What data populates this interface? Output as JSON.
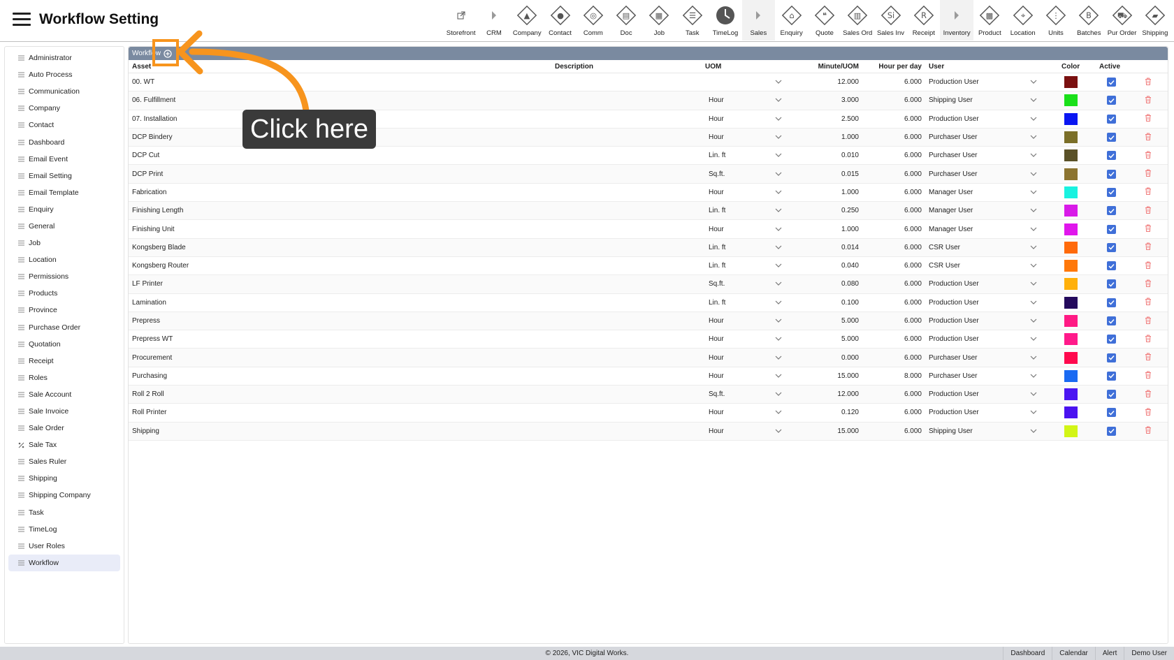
{
  "header": {
    "title": "Workflow Setting",
    "nav": [
      {
        "label": "Storefront",
        "icon": "external-link-icon",
        "group": false
      },
      {
        "label": "CRM",
        "icon": "caret-right-icon",
        "group": false
      },
      {
        "label": "Company",
        "icon": "company-icon",
        "group": false
      },
      {
        "label": "Contact",
        "icon": "contact-icon",
        "group": false
      },
      {
        "label": "Comm",
        "icon": "comm-icon",
        "group": false
      },
      {
        "label": "Doc",
        "icon": "doc-icon",
        "group": false
      },
      {
        "label": "Job",
        "icon": "job-icon",
        "group": false
      },
      {
        "label": "Task",
        "icon": "task-icon",
        "group": false
      },
      {
        "label": "TimeLog",
        "icon": "clock-icon",
        "group": false
      },
      {
        "label": "Sales",
        "icon": "caret-right-icon",
        "group": true
      },
      {
        "label": "Enquiry",
        "icon": "enquiry-icon",
        "group": false
      },
      {
        "label": "Quote",
        "icon": "quote-icon",
        "group": false
      },
      {
        "label": "Sales Ord",
        "icon": "sales-order-icon",
        "group": false
      },
      {
        "label": "Sales Inv",
        "icon": "sales-invoice-icon",
        "group": false
      },
      {
        "label": "Receipt",
        "icon": "receipt-icon",
        "group": false
      },
      {
        "label": "Inventory",
        "icon": "caret-right-icon",
        "group": true
      },
      {
        "label": "Product",
        "icon": "product-icon",
        "group": false
      },
      {
        "label": "Location",
        "icon": "location-icon",
        "group": false
      },
      {
        "label": "Units",
        "icon": "units-icon",
        "group": false
      },
      {
        "label": "Batches",
        "icon": "batches-icon",
        "group": false
      },
      {
        "label": "Pur Order",
        "icon": "purchase-order-icon",
        "group": false
      },
      {
        "label": "Shipping",
        "icon": "shipping-icon",
        "group": false
      }
    ]
  },
  "sidebar": {
    "items": [
      {
        "label": "Administrator"
      },
      {
        "label": "Auto Process"
      },
      {
        "label": "Communication"
      },
      {
        "label": "Company"
      },
      {
        "label": "Contact"
      },
      {
        "label": "Dashboard"
      },
      {
        "label": "Email Event"
      },
      {
        "label": "Email Setting"
      },
      {
        "label": "Email Template"
      },
      {
        "label": "Enquiry"
      },
      {
        "label": "General"
      },
      {
        "label": "Job"
      },
      {
        "label": "Location"
      },
      {
        "label": "Permissions"
      },
      {
        "label": "Products"
      },
      {
        "label": "Province"
      },
      {
        "label": "Purchase Order"
      },
      {
        "label": "Quotation"
      },
      {
        "label": "Receipt"
      },
      {
        "label": "Roles"
      },
      {
        "label": "Sale Account"
      },
      {
        "label": "Sale Invoice"
      },
      {
        "label": "Sale Order"
      },
      {
        "label": "Sale Tax",
        "icon": "percent-icon"
      },
      {
        "label": "Sales Ruler"
      },
      {
        "label": "Shipping"
      },
      {
        "label": "Shipping Company"
      },
      {
        "label": "Task"
      },
      {
        "label": "TimeLog"
      },
      {
        "label": "User Roles"
      },
      {
        "label": "Workflow",
        "active": true
      }
    ]
  },
  "panel": {
    "title": "Workflow",
    "columns": {
      "asset": "Asset",
      "description": "Description",
      "uom": "UOM",
      "minute_uom": "Minute/UOM",
      "hour_per_day": "Hour per day",
      "user": "User",
      "color": "Color",
      "active": "Active"
    },
    "rows": [
      {
        "asset": "00. WT",
        "description": "",
        "uom": "",
        "minute": "12.000",
        "hours": "6.000",
        "user": "Production User",
        "color": "#7a1010",
        "active": true
      },
      {
        "asset": "06. Fulfillment",
        "description": "",
        "uom": "Hour",
        "minute": "3.000",
        "hours": "6.000",
        "user": "Shipping User",
        "color": "#1ae01a",
        "active": true
      },
      {
        "asset": "07. Installation",
        "description": "",
        "uom": "Hour",
        "minute": "2.500",
        "hours": "6.000",
        "user": "Production User",
        "color": "#0a16f2",
        "active": true
      },
      {
        "asset": "DCP Bindery",
        "description": "",
        "uom": "Hour",
        "minute": "1.000",
        "hours": "6.000",
        "user": "Purchaser User",
        "color": "#7b6f28",
        "active": true
      },
      {
        "asset": "DCP Cut",
        "description": "",
        "uom": "Lin. ft",
        "minute": "0.010",
        "hours": "6.000",
        "user": "Purchaser User",
        "color": "#5a5128",
        "active": true
      },
      {
        "asset": "DCP Print",
        "description": "",
        "uom": "Sq.ft.",
        "minute": "0.015",
        "hours": "6.000",
        "user": "Purchaser User",
        "color": "#8c7430",
        "active": true
      },
      {
        "asset": "Fabrication",
        "description": "",
        "uom": "Hour",
        "minute": "1.000",
        "hours": "6.000",
        "user": "Manager User",
        "color": "#19f2e0",
        "active": true
      },
      {
        "asset": "Finishing Length",
        "description": "",
        "uom": "Lin. ft",
        "minute": "0.250",
        "hours": "6.000",
        "user": "Manager User",
        "color": "#d81ae8",
        "active": true
      },
      {
        "asset": "Finishing Unit",
        "description": "",
        "uom": "Hour",
        "minute": "1.000",
        "hours": "6.000",
        "user": "Manager User",
        "color": "#e016ec",
        "active": true
      },
      {
        "asset": "Kongsberg Blade",
        "description": "",
        "uom": "Lin. ft",
        "minute": "0.014",
        "hours": "6.000",
        "user": "CSR User",
        "color": "#ff6a0a",
        "active": true
      },
      {
        "asset": "Kongsberg Router",
        "description": "",
        "uom": "Lin. ft",
        "minute": "0.040",
        "hours": "6.000",
        "user": "CSR User",
        "color": "#ff780a",
        "active": true
      },
      {
        "asset": "LF Printer",
        "description": "",
        "uom": "Sq.ft.",
        "minute": "0.080",
        "hours": "6.000",
        "user": "Production User",
        "color": "#ffb00a",
        "active": true
      },
      {
        "asset": "Lamination",
        "description": "",
        "uom": "Lin. ft",
        "minute": "0.100",
        "hours": "6.000",
        "user": "Production User",
        "color": "#240a5c",
        "active": true
      },
      {
        "asset": "Prepress",
        "description": "",
        "uom": "Hour",
        "minute": "5.000",
        "hours": "6.000",
        "user": "Production User",
        "color": "#ff1a84",
        "active": true
      },
      {
        "asset": "Prepress WT",
        "description": "",
        "uom": "Hour",
        "minute": "5.000",
        "hours": "6.000",
        "user": "Production User",
        "color": "#ff1a8a",
        "active": true
      },
      {
        "asset": "Procurement",
        "description": "",
        "uom": "Hour",
        "minute": "0.000",
        "hours": "6.000",
        "user": "Purchaser User",
        "color": "#ff0a4e",
        "active": true
      },
      {
        "asset": "Purchasing",
        "description": "",
        "uom": "Hour",
        "minute": "15.000",
        "hours": "8.000",
        "user": "Purchaser User",
        "color": "#1a6af2",
        "active": true
      },
      {
        "asset": "Roll 2 Roll",
        "description": "",
        "uom": "Sq.ft.",
        "minute": "12.000",
        "hours": "6.000",
        "user": "Production User",
        "color": "#4a16f2",
        "active": true
      },
      {
        "asset": "Roll Printer",
        "description": "",
        "uom": "Hour",
        "minute": "0.120",
        "hours": "6.000",
        "user": "Production User",
        "color": "#4a12f0",
        "active": true
      },
      {
        "asset": "Shipping",
        "description": "",
        "uom": "Hour",
        "minute": "15.000",
        "hours": "6.000",
        "user": "Shipping User",
        "color": "#d2f516",
        "active": true
      }
    ]
  },
  "footer": {
    "copyright": "© 2026, VIC Digital Works.",
    "links": [
      "Dashboard",
      "Calendar",
      "Alert",
      "Demo User"
    ]
  },
  "annotation": {
    "callout_text": "Click here",
    "accent": "#f7941d"
  }
}
